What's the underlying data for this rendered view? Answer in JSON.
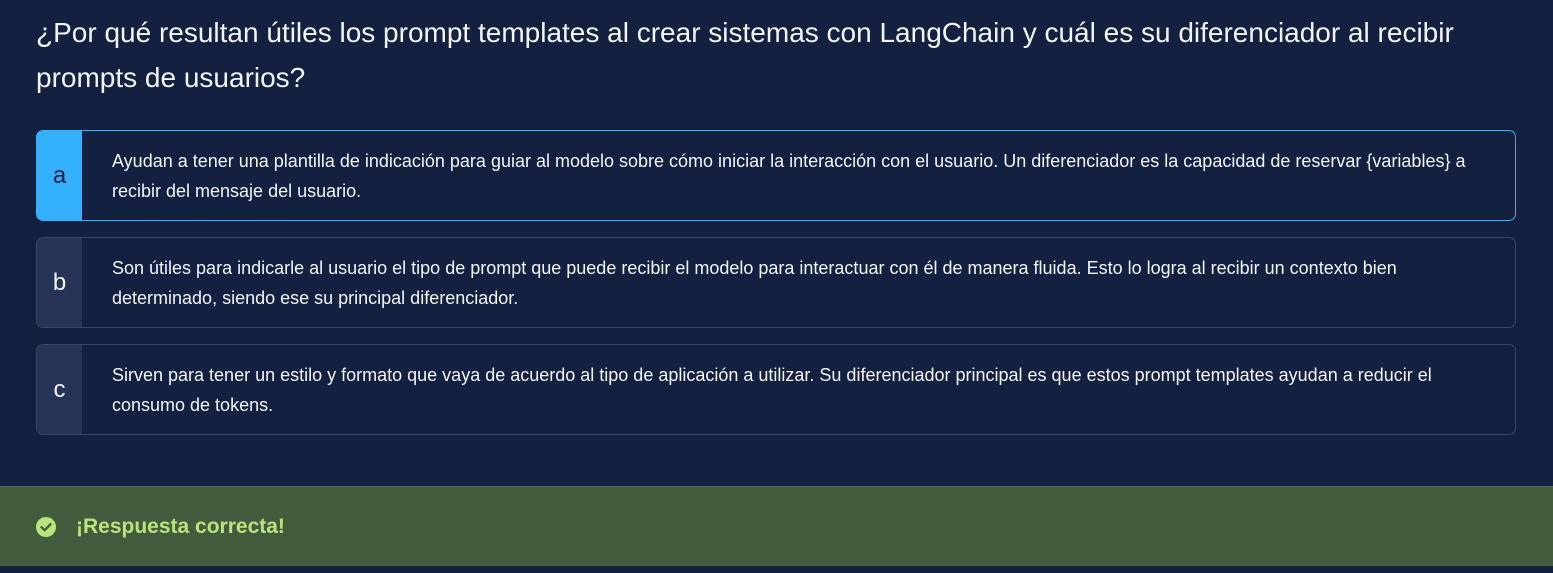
{
  "question": {
    "text": "¿Por qué resultan útiles los prompt templates al crear sistemas con LangChain y cuál es su diferenciador al recibir prompts de usuarios?"
  },
  "options": [
    {
      "letter": "a",
      "text": "Ayudan a tener una plantilla de indicación para guiar al modelo sobre cómo iniciar la interacción con el usuario. Un diferenciador es la capacidad de reservar {variables} a recibir del mensaje del usuario.",
      "selected": true
    },
    {
      "letter": "b",
      "text": "Son útiles para indicarle al usuario el tipo de prompt que puede recibir el modelo para interactuar con él de manera fluida. Esto lo logra al recibir un contexto bien determinado, siendo ese su principal diferenciador.",
      "selected": false
    },
    {
      "letter": "c",
      "text": "Sirven para tener un estilo y formato que vaya de acuerdo al tipo de aplicación a utilizar. Su diferenciador principal es que estos prompt templates ayudan a reducir el consumo de tokens.",
      "selected": false
    }
  ],
  "feedback": {
    "text": "¡Respuesta correcta!",
    "icon": "check-circle-icon"
  },
  "colors": {
    "background": "#13203f",
    "selected_accent": "#33b1ff",
    "success_bar": "#435c3d",
    "success_text": "#b9e57a"
  }
}
